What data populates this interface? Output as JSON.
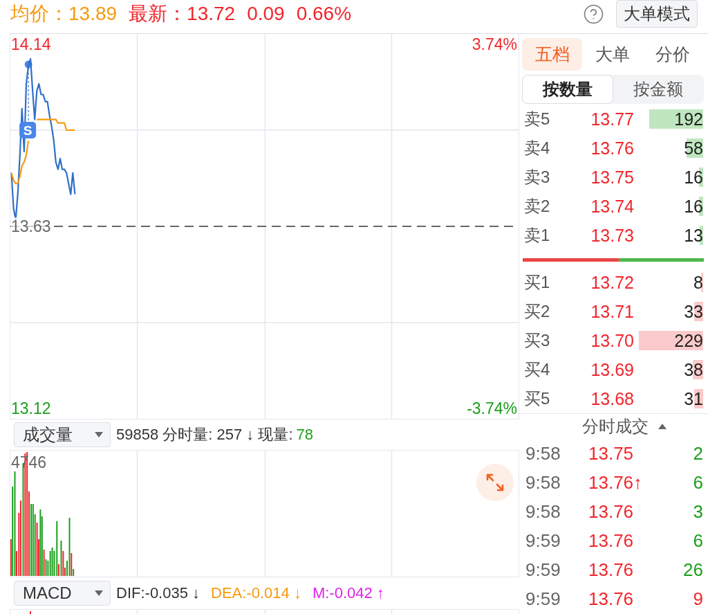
{
  "quote": [
    {
      "kind": "average",
      "text": "均价：13.89"
    },
    {
      "kind": "latest",
      "text": "最新：13.72"
    },
    {
      "kind": "change",
      "text": "0.09"
    },
    {
      "kind": "change_percent",
      "text": "0.66%"
    }
  ],
  "mode_button": "大单模式",
  "price_chart": {
    "high_percent": "3.74%",
    "low_percent": "-3.74%",
    "chart_data": {
      "type": "line",
      "categories": [
        null,
        null,
        null,
        null,
        null,
        null,
        null,
        null,
        null,
        null,
        null,
        null,
        null,
        null,
        null,
        null,
        null,
        null,
        null,
        null,
        null,
        null,
        null,
        null,
        null,
        null,
        null,
        null,
        null,
        null,
        null,
        null,
        null,
        null,
        null,
        null,
        null,
        null,
        null,
        null,
        null,
        null,
        null,
        null,
        null,
        null,
        null,
        null,
        null,
        null,
        null,
        null,
        null,
        null,
        null,
        null,
        null,
        null,
        null,
        null,
        null,
        null,
        null,
        null,
        null,
        null,
        null,
        null,
        null,
        null,
        null,
        null,
        null,
        null,
        null,
        null,
        null,
        null,
        null,
        null,
        null,
        null,
        null,
        null,
        null,
        null,
        null,
        null,
        null,
        null,
        null,
        null,
        null,
        null,
        null,
        null,
        null,
        null,
        null,
        null,
        null,
        null,
        null,
        null,
        null,
        null,
        null,
        null,
        null,
        null,
        null,
        null,
        null,
        null,
        null,
        null,
        null,
        null,
        null,
        null,
        null,
        null,
        null,
        null,
        null,
        null,
        null,
        null,
        null,
        null,
        null,
        null,
        null,
        null,
        null,
        null,
        null,
        null,
        null,
        null,
        null,
        null,
        null,
        null,
        null,
        null,
        null,
        null,
        null,
        null,
        null,
        null,
        null,
        null,
        null,
        null,
        null,
        null,
        null,
        null,
        null,
        null,
        null,
        null,
        null,
        null,
        null,
        null,
        null,
        null,
        null,
        null,
        null,
        null,
        null,
        null,
        null,
        null,
        null,
        null,
        null,
        null,
        null,
        null,
        null,
        null,
        null,
        null,
        null,
        null,
        null,
        null,
        null,
        null,
        null,
        null,
        null,
        null,
        null,
        null,
        null,
        null,
        null,
        null,
        null,
        null,
        null,
        null,
        null,
        null,
        null,
        null,
        null,
        null,
        null,
        null,
        null,
        null,
        null,
        null,
        null,
        null,
        null,
        null,
        null,
        null,
        null,
        null,
        null,
        null,
        null,
        null,
        null,
        null,
        null,
        null,
        null,
        null,
        null,
        null
      ],
      "ylim": [
        13.09,
        14.17
      ],
      "yticks": [
        {
          "value": 14.14,
          "label": "14.14"
        },
        {
          "value": 13.12,
          "label": "13.12"
        }
      ],
      "ref_lines": [
        {
          "axis": "y",
          "value": 13.63,
          "label": "13.63"
        }
      ],
      "series": [
        {
          "color": "#2f6fc9",
          "values": [
            13.78,
            13.68,
            13.65,
            13.72,
            13.83,
            13.96,
            13.84,
            14.03,
            14.08,
            14.1,
            14.01,
            13.93,
            14.01,
            14.03,
            14.0,
            14.0,
            13.98,
            13.98,
            13.94,
            13.91,
            13.87,
            13.81,
            13.79,
            13.82,
            13.79,
            13.79,
            13.78,
            13.75,
            13.72,
            13.78,
            13.72,
            null,
            null,
            null,
            null,
            null,
            null,
            null,
            null,
            null,
            null,
            null,
            null,
            null,
            null,
            null,
            null,
            null,
            null,
            null,
            null,
            null,
            null,
            null,
            null,
            null,
            null,
            null,
            null,
            null,
            null,
            null,
            null,
            null,
            null,
            null,
            null,
            null,
            null,
            null,
            null,
            null,
            null,
            null,
            null,
            null,
            null,
            null,
            null,
            null,
            null,
            null,
            null,
            null,
            null,
            null,
            null,
            null,
            null,
            null,
            null,
            null,
            null,
            null,
            null,
            null,
            null,
            null,
            null,
            null,
            null,
            null,
            null,
            null,
            null,
            null,
            null,
            null,
            null,
            null,
            null,
            null,
            null,
            null,
            null,
            null,
            null,
            null,
            null,
            null,
            null,
            null,
            null,
            null,
            null,
            null,
            null,
            null,
            null,
            null,
            null,
            null,
            null,
            null,
            null,
            null,
            null,
            null,
            null,
            null,
            null,
            null,
            null,
            null,
            null,
            null,
            null,
            null,
            null,
            null,
            null,
            null,
            null,
            null,
            null,
            null,
            null,
            null,
            null,
            null,
            null,
            null,
            null,
            null,
            null,
            null,
            null,
            null,
            null,
            null,
            null,
            null,
            null,
            null,
            null,
            null,
            null,
            null,
            null,
            null,
            null,
            null,
            null,
            null,
            null,
            null,
            null,
            null,
            null,
            null,
            null,
            null,
            null,
            null,
            null,
            null,
            null,
            null,
            null,
            null,
            null,
            null,
            null,
            null,
            null,
            null,
            null,
            null,
            null,
            null,
            null,
            null,
            null,
            null,
            null,
            null,
            null,
            null,
            null,
            null,
            null,
            null,
            null,
            null,
            null,
            null,
            null,
            null,
            null,
            null,
            null,
            null,
            null,
            null,
            null,
            null,
            null,
            null,
            null,
            null
          ]
        },
        {
          "color": "#f59a0c",
          "values": [
            13.78,
            13.76,
            13.75,
            13.75,
            13.77,
            13.8,
            13.81,
            13.83,
            13.87,
            null,
            null,
            null,
            13.93,
            13.93,
            13.93,
            13.93,
            13.93,
            13.93,
            13.93,
            13.93,
            13.93,
            13.93,
            13.92,
            13.92,
            13.92,
            13.92,
            13.9,
            13.9,
            13.9,
            13.9,
            13.9,
            null,
            null,
            null,
            null,
            null,
            null,
            null,
            null,
            null,
            null,
            null,
            null,
            null,
            null,
            null,
            null,
            null,
            null,
            null,
            null,
            null,
            null,
            null,
            null,
            null,
            null,
            null,
            null,
            null,
            null,
            null,
            null,
            null,
            null,
            null,
            null,
            null,
            null,
            null,
            null,
            null,
            null,
            null,
            null,
            null,
            null,
            null,
            null,
            null,
            null,
            null,
            null,
            null,
            null,
            null,
            null,
            null,
            null,
            null,
            null,
            null,
            null,
            null,
            null,
            null,
            null,
            null,
            null,
            null,
            null,
            null,
            null,
            null,
            null,
            null,
            null,
            null,
            null,
            null,
            null,
            null,
            null,
            null,
            null,
            null,
            null,
            null,
            null,
            null,
            null,
            null,
            null,
            null,
            null,
            null,
            null,
            null,
            null,
            null,
            null,
            null,
            null,
            null,
            null,
            null,
            null,
            null,
            null,
            null,
            null,
            null,
            null,
            null,
            null,
            null,
            null,
            null,
            null,
            null,
            null,
            null,
            null,
            null,
            null,
            null,
            null,
            null,
            null,
            null,
            null,
            null,
            null,
            null,
            null,
            null,
            null,
            null,
            null,
            null,
            null,
            null,
            null,
            null,
            null,
            null,
            null,
            null,
            null,
            null,
            null,
            null,
            null,
            null,
            null,
            null,
            null,
            null,
            null,
            null,
            null,
            null,
            null,
            null,
            null,
            null,
            null,
            null,
            null,
            null,
            null,
            null,
            null,
            null,
            null,
            null,
            null,
            null,
            null,
            null,
            null,
            null,
            null,
            null,
            null,
            null,
            null,
            null,
            null,
            null,
            null,
            null,
            null,
            null,
            null,
            null,
            null,
            null,
            null,
            null,
            null,
            null,
            null,
            null,
            null,
            null,
            null,
            null,
            null,
            null
          ]
        }
      ],
      "annotations": [
        {
          "text": "S"
        }
      ]
    }
  },
  "volume_panel": {
    "indicator": "成交量",
    "summary": "59858 分时量: 257 ↓ 现量:",
    "current": "78",
    "max_label": "4746"
  },
  "macd_panel": {
    "indicator": "MACD",
    "values": [
      {
        "text": "DIF:-0.035 ↓",
        "color": "#333333"
      },
      {
        "text": "DEA:-0.014 ↓",
        "color": "#f59a0c"
      },
      {
        "text": "M:-0.042 ↑",
        "color": "#e020e6"
      }
    ]
  },
  "depth_tabs": [
    {
      "label": "五档",
      "selected": true
    },
    {
      "label": "大单",
      "selected": false
    },
    {
      "label": "分价",
      "selected": false
    }
  ],
  "unit_toggle": [
    {
      "label": "按数量",
      "selected": true
    },
    {
      "label": "按金额",
      "selected": false
    }
  ],
  "asks": [
    {
      "label": "卖5",
      "price": "13.77",
      "volume": "192"
    },
    {
      "label": "卖4",
      "price": "13.76",
      "volume": "58"
    },
    {
      "label": "卖3",
      "price": "13.75",
      "volume": "16"
    },
    {
      "label": "卖2",
      "price": "13.74",
      "volume": "16"
    },
    {
      "label": "卖1",
      "price": "13.73",
      "volume": "13"
    }
  ],
  "order_ratio": {
    "level": 0.53
  },
  "bids": [
    {
      "label": "买1",
      "price": "13.72",
      "volume": "8"
    },
    {
      "label": "买2",
      "price": "13.71",
      "volume": "33"
    },
    {
      "label": "买3",
      "price": "13.70",
      "volume": "229"
    },
    {
      "label": "买4",
      "price": "13.69",
      "volume": "38"
    },
    {
      "label": "买5",
      "price": "13.68",
      "volume": "31"
    }
  ],
  "trades_title": "分时成交",
  "trades": [
    {
      "time": "9:58",
      "price": "13.75",
      "volume": "2",
      "color": "#1a9f1a"
    },
    {
      "time": "9:58",
      "price": "13.76↑",
      "volume": "6",
      "color": "#1a9f1a"
    },
    {
      "time": "9:58",
      "price": "13.76",
      "volume": "3",
      "color": "#1a9f1a"
    },
    {
      "time": "9:59",
      "price": "13.76",
      "volume": "6",
      "color": "#1a9f1a"
    },
    {
      "time": "9:59",
      "price": "13.76",
      "volume": "26",
      "color": "#1a9f1a"
    },
    {
      "time": "9:59",
      "price": "13.76",
      "volume": "9",
      "color": "#f0262c"
    }
  ]
}
